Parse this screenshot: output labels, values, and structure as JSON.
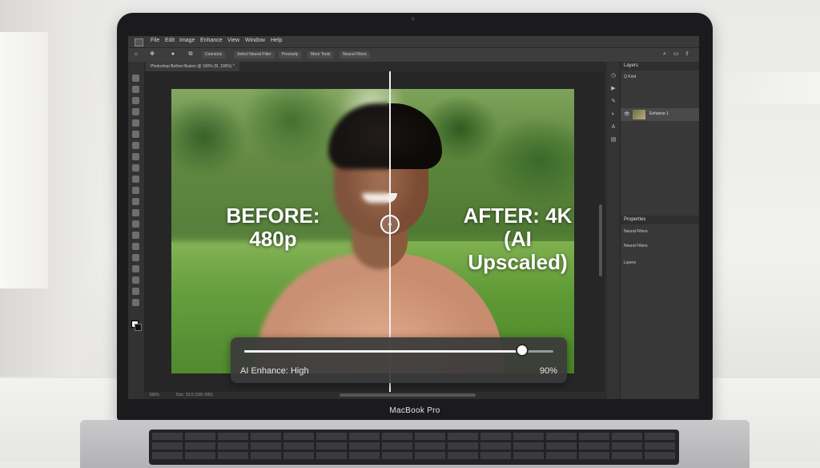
{
  "menu": [
    "File",
    "Edit",
    "Image",
    "Enhance",
    "View",
    "Window",
    "Help"
  ],
  "options_bar": {
    "buttons": [
      "Connects",
      "Select Neural Filter",
      "Precisely",
      "More Tools",
      "Neural Filters"
    ]
  },
  "document": {
    "tab_title": "Photoshop Before:Illusion @ 100% (R, 100%) *"
  },
  "overlay": {
    "before_label_line1": "BEFORE:",
    "before_label_line2": "480p",
    "after_label_line1": "AFTER: 4K",
    "after_label_line2": "(AI Upscaled)"
  },
  "enhance_slider": {
    "label": "AI Enhance: High",
    "value_text": "90%",
    "value": 0.9
  },
  "panels": {
    "layers": {
      "title": "Layers",
      "kind": "Q Kind",
      "layer_name": "Enhance 1"
    },
    "properties": {
      "title": "Properties",
      "items": [
        "Neural Filters",
        "Neural Filters",
        "Layers"
      ]
    }
  },
  "status": {
    "zoom": "100%",
    "info": "Doc: 10.0 (150~200)"
  },
  "device_label": "MacBook Pro"
}
